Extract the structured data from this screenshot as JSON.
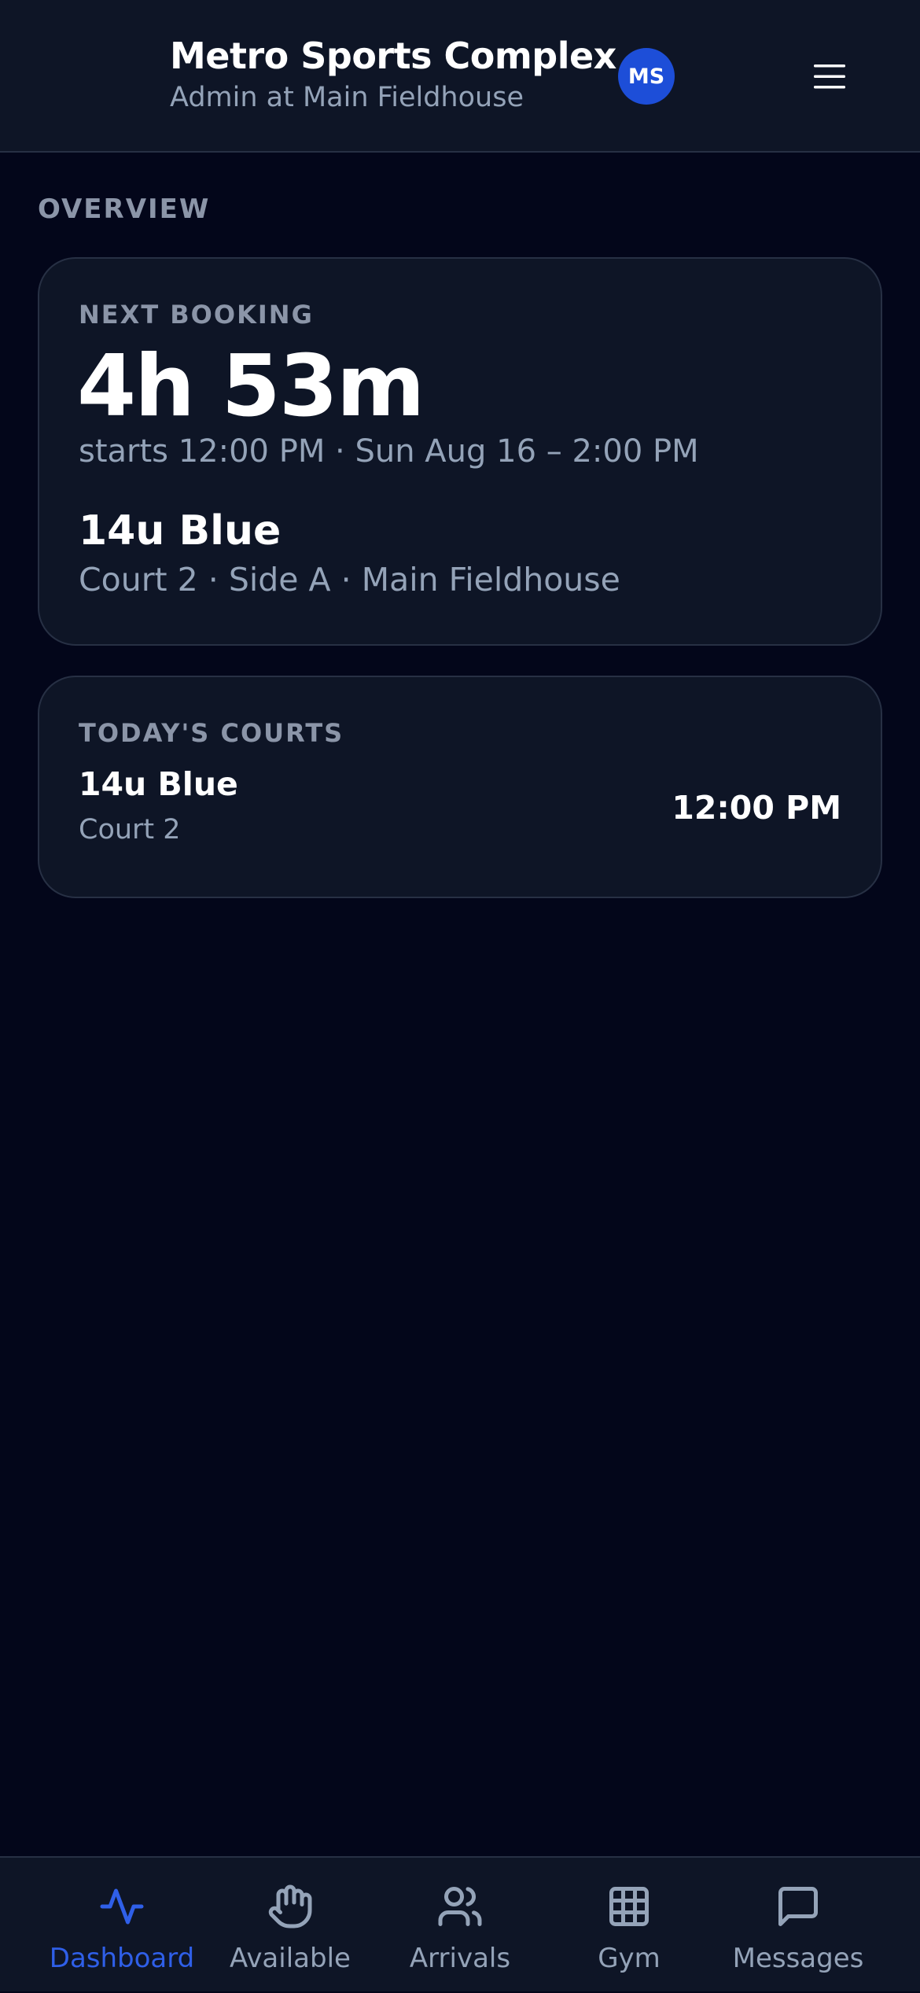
{
  "colors": {
    "background": "#03061a",
    "surface": "#0e1526",
    "border": "#273044",
    "accent": "#2f5fe8",
    "avatar": "#1d4ed8",
    "muted_text": "#94a3b8"
  },
  "header": {
    "title": "Metro Sports Complex",
    "subtitle": "Admin at Main Fieldhouse",
    "avatar_initials": "MS",
    "menu_icon": "hamburger-menu-icon"
  },
  "overview": {
    "section_label": "OVERVIEW"
  },
  "next_booking": {
    "label": "NEXT BOOKING",
    "countdown": "4h 53m",
    "time": "starts 12:00 PM · Sun Aug 16 – 2:00 PM",
    "team": "14u Blue",
    "location": "Court 2 · Side A · Main Fieldhouse"
  },
  "todays_courts": {
    "label": "TODAY'S COURTS",
    "items": [
      {
        "team": "14u Blue",
        "court": "Court 2",
        "time": "12:00 PM"
      }
    ]
  },
  "bottom_nav": {
    "active": "Dashboard",
    "items": [
      {
        "label": "Dashboard",
        "icon": "activity-pulse-icon"
      },
      {
        "label": "Available",
        "icon": "raised-hand-icon"
      },
      {
        "label": "Arrivals",
        "icon": "users-icon"
      },
      {
        "label": "Gym",
        "icon": "grid-icon"
      },
      {
        "label": "Messages",
        "icon": "message-bubble-icon"
      }
    ]
  }
}
